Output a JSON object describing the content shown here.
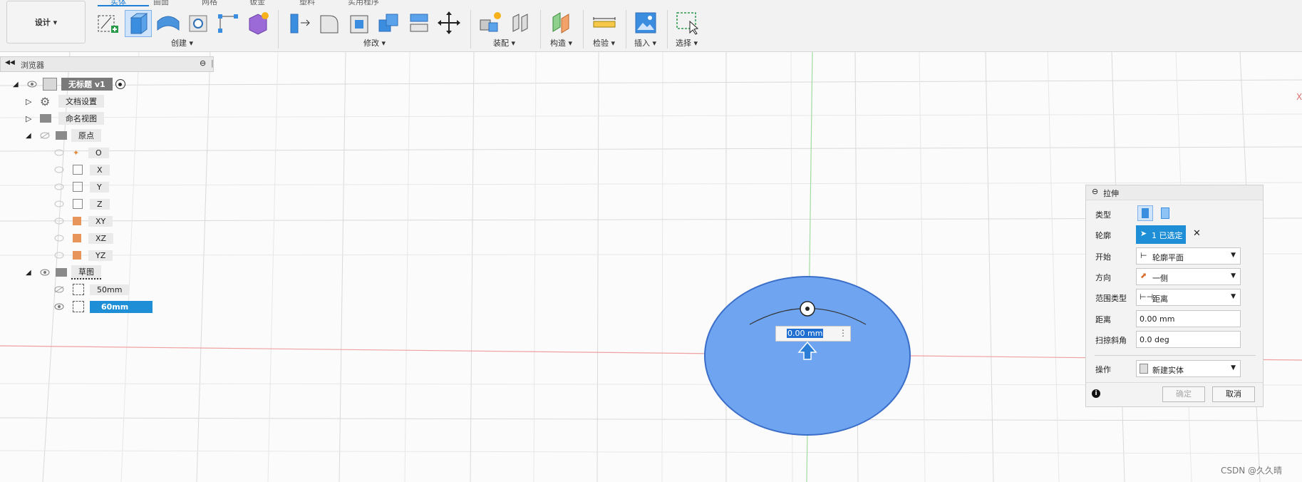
{
  "toolbar": {
    "design_label": "设计 ▾",
    "tabs": [
      "实体",
      "曲面",
      "网格",
      "钣金",
      "塑料",
      "实用程序"
    ],
    "groups": {
      "create": "创建 ▾",
      "modify": "修改 ▾",
      "assemble": "装配 ▾",
      "construct": "构造 ▾",
      "inspect": "检验 ▾",
      "insert": "插入 ▾",
      "select": "选择 ▾"
    },
    "accent": "#1e7fd6"
  },
  "browser": {
    "title": "浏览器",
    "root": "无标题 v1",
    "items": {
      "doc_settings": "文档设置",
      "named_views": "命名视图",
      "origin": "原点",
      "o": "O",
      "x": "X",
      "y": "Y",
      "z": "Z",
      "xy": "XY",
      "xz": "XZ",
      "yz": "YZ",
      "sketches": "草图",
      "sketch1": "50mm",
      "sketch2": "60mm"
    }
  },
  "canvas": {
    "distance_value": "0.00 mm",
    "axis_label_x": "X",
    "watermark": "CSDN @久久晴"
  },
  "panel": {
    "title": "拉伸",
    "type_label": "类型",
    "profile_label": "轮廓",
    "profile_value": "1 已选定",
    "start_label": "开始",
    "start_value": "轮廓平面",
    "direction_label": "方向",
    "direction_value": "一侧",
    "extent_label": "范围类型",
    "extent_value": "距离",
    "distance_label": "距离",
    "distance_value": "0.00 mm",
    "taper_label": "扫掠斜角",
    "taper_value": "0.0 deg",
    "operation_label": "操作",
    "operation_value": "新建实体",
    "ok_label": "确定",
    "cancel_label": "取消"
  }
}
